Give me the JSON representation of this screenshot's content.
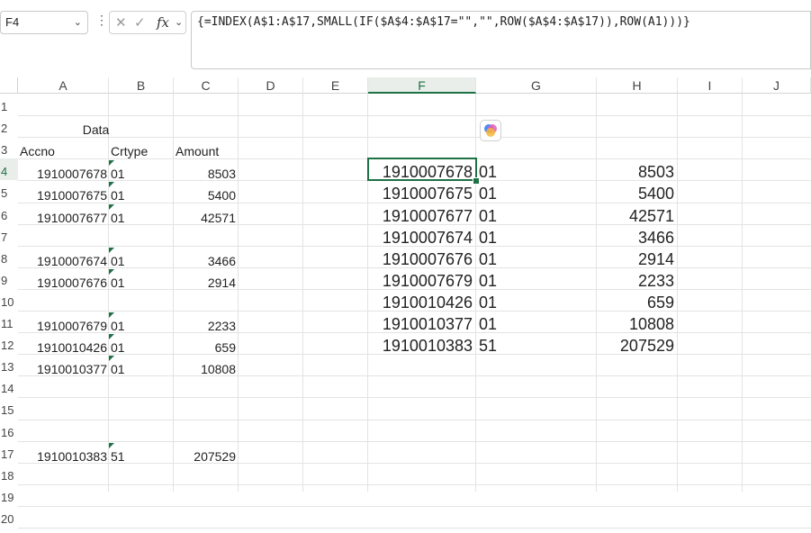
{
  "formula_bar": {
    "name_box": "F4",
    "cancel_icon": "✕",
    "enter_icon": "✓",
    "fx_label": "fx",
    "formula": "{=INDEX(A$1:A$17,SMALL(IF($A$4:$A$17=\"\",\"\",ROW($A$4:$A$17)),ROW(A1)))}"
  },
  "columns": [
    "A",
    "B",
    "C",
    "D",
    "E",
    "F",
    "G",
    "H",
    "I",
    "J"
  ],
  "rows": [
    "1",
    "2",
    "3",
    "4",
    "5",
    "6",
    "7",
    "8",
    "9",
    "10",
    "11",
    "12",
    "13",
    "14",
    "15",
    "16",
    "17",
    "18",
    "19",
    "20"
  ],
  "source": {
    "title": "Data",
    "headers": [
      "Accno",
      "Crtype",
      "Amount"
    ],
    "rows": [
      {
        "row": "4",
        "accno": "1910007678",
        "crtype": "01",
        "amount": "8503"
      },
      {
        "row": "5",
        "accno": "1910007675",
        "crtype": "01",
        "amount": "5400"
      },
      {
        "row": "6",
        "accno": "1910007677",
        "crtype": "01",
        "amount": "42571"
      },
      {
        "row": "8",
        "accno": "1910007674",
        "crtype": "01",
        "amount": "3466"
      },
      {
        "row": "9",
        "accno": "1910007676",
        "crtype": "01",
        "amount": "2914"
      },
      {
        "row": "11",
        "accno": "1910007679",
        "crtype": "01",
        "amount": "2233"
      },
      {
        "row": "12",
        "accno": "1910010426",
        "crtype": "01",
        "amount": "659"
      },
      {
        "row": "13",
        "accno": "1910010377",
        "crtype": "01",
        "amount": "10808"
      },
      {
        "row": "17",
        "accno": "1910010383",
        "crtype": "51",
        "amount": "207529"
      }
    ]
  },
  "result": [
    {
      "accno": "1910007678",
      "crtype": "01",
      "amount": "8503"
    },
    {
      "accno": "1910007675",
      "crtype": "01",
      "amount": "5400"
    },
    {
      "accno": "1910007677",
      "crtype": "01",
      "amount": "42571"
    },
    {
      "accno": "1910007674",
      "crtype": "01",
      "amount": "3466"
    },
    {
      "accno": "1910007676",
      "crtype": "01",
      "amount": "2914"
    },
    {
      "accno": "1910007679",
      "crtype": "01",
      "amount": "2233"
    },
    {
      "accno": "1910010426",
      "crtype": "01",
      "amount": "659"
    },
    {
      "accno": "1910010377",
      "crtype": "01",
      "amount": "10808"
    },
    {
      "accno": "1910010383",
      "crtype": "51",
      "amount": "207529"
    }
  ],
  "colors": {
    "accent": "#1e7145"
  },
  "icons": {
    "copilot": "copilot-icon"
  }
}
